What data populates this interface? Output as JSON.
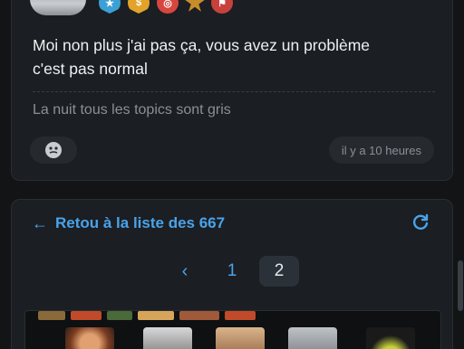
{
  "post": {
    "text_line1": "Moi non plus j'ai pas ça, vous avez un problème",
    "text_line2": "c'est pas normal",
    "signature": "La nuit tous les topics sont gris",
    "timestamp": "il y a 10 heures",
    "badges": [
      "star-badge",
      "dollar-badge",
      "target-badge",
      "sheriff-badge",
      "flag-badge"
    ]
  },
  "navigation": {
    "back_label": "Retou à la liste des 667",
    "pages": [
      "1",
      "2"
    ],
    "current_page": "2",
    "prev_glyph": "‹"
  },
  "colors": {
    "accent": "#4aa3ea",
    "background": "#121416",
    "card": "#1b1e22"
  }
}
